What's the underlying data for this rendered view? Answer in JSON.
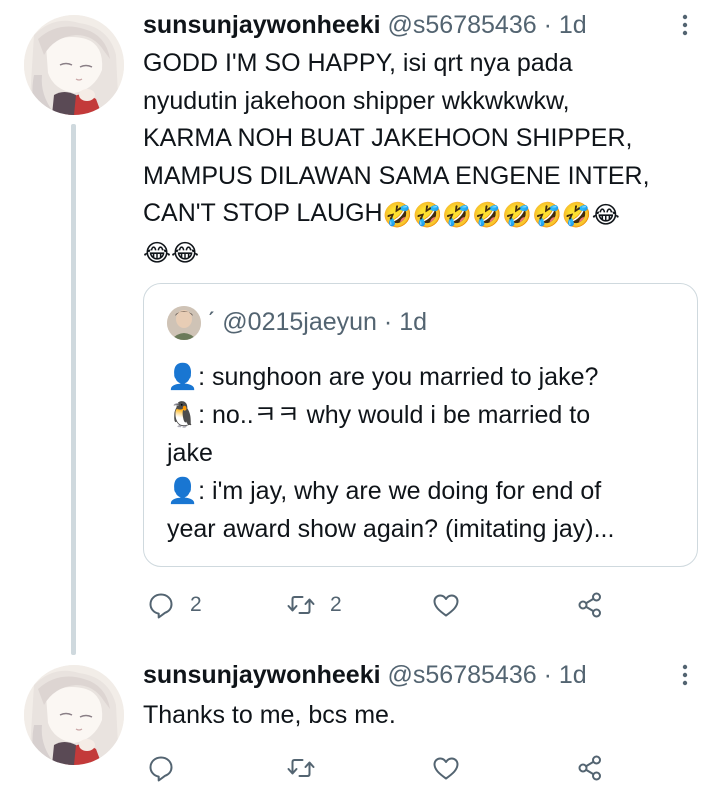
{
  "tweets": [
    {
      "author": {
        "name": "sunsunjaywonheeki",
        "handle": "@s56785436",
        "separator": "·",
        "time": "1d"
      },
      "text": "GODD I'M SO HAPPY, isi qrt nya pada\nnyudutin jakehoon shipper wkkwkwkw,\nKARMA NOH BUAT JAKEHOON SHIPPER,\nMAMPUS DILAWAN SAMA ENGENE INTER,\nCAN'T STOP LAUGH",
      "trailing_emoji_line1": "🤣🤣🤣🤣🤣🤣🤣😂",
      "trailing_emoji_line2": "😂😂",
      "quote": {
        "display_name": "ˊ",
        "handle": "@0215jaeyun",
        "separator": "·",
        "time": "1d",
        "text": "👤: sunghoon are you married to jake?\n🐧: no..ㅋㅋ why would i be married to\njake\n👤: i'm jay, why are we doing for end of\nyear award show again? (imitating jay)..."
      },
      "actions": {
        "reply_count": "2",
        "retweet_count": "2",
        "like_count": "",
        "share_count": ""
      }
    },
    {
      "author": {
        "name": "sunsunjaywonheeki",
        "handle": "@s56785436",
        "separator": "·",
        "time": "1d"
      },
      "text": "Thanks to me, bcs me.",
      "actions": {
        "reply_count": "",
        "retweet_count": "",
        "like_count": "",
        "share_count": ""
      }
    }
  ],
  "colors": {
    "text_primary": "#0f1419",
    "text_secondary": "#536471",
    "border": "#cfd9de",
    "thread_line": "#cfd9de"
  },
  "icons": [
    "more-icon",
    "reply-icon",
    "retweet-icon",
    "like-icon",
    "share-icon"
  ]
}
